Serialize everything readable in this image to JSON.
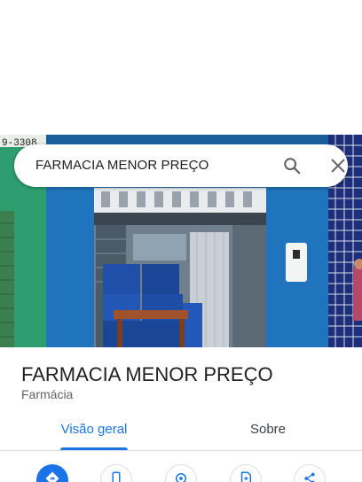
{
  "search": {
    "query": "FARMACIA MENOR PREÇO"
  },
  "photo": {
    "sign_text": "9-3308"
  },
  "place": {
    "name": "FARMACIA MENOR PREÇO",
    "category": "Farmácia"
  },
  "tabs": [
    {
      "label": "Visão geral",
      "selected": true
    },
    {
      "label": "Sobre",
      "selected": false
    }
  ],
  "actions": [
    {
      "icon": "directions-icon"
    },
    {
      "icon": "phone-icon"
    },
    {
      "icon": "location-pin-icon"
    },
    {
      "icon": "save-document-icon"
    },
    {
      "icon": "share-icon"
    }
  ],
  "colors": {
    "accent": "#1a73e8",
    "wall_blue": "#1f6fb0",
    "wall_green": "#2e9b6c",
    "tile_blue": "#1d2f7a"
  }
}
